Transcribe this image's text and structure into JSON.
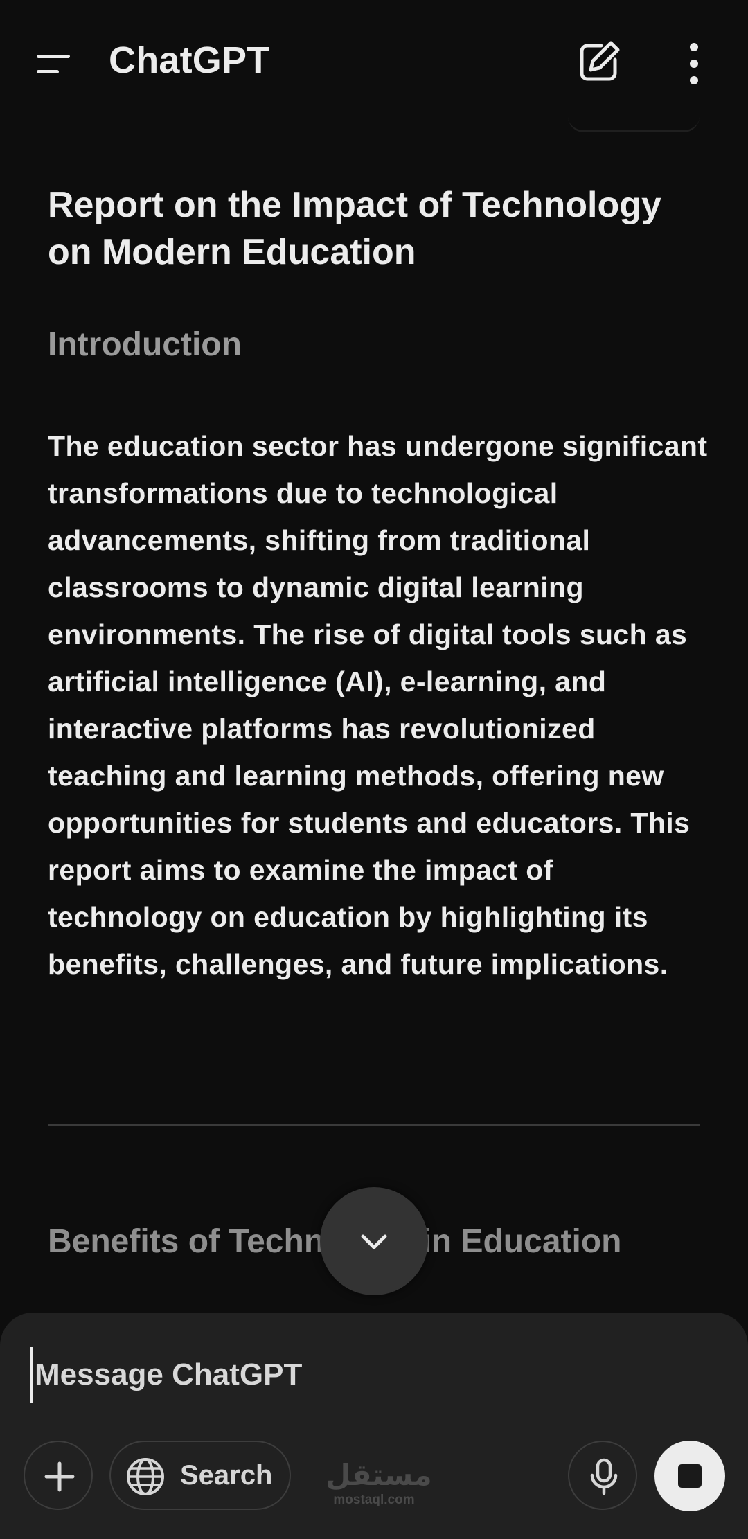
{
  "header": {
    "app_title": "ChatGPT",
    "menu_icon": "hamburger-menu-icon",
    "new_chat_icon": "compose-icon",
    "more_icon": "vertical-ellipsis-icon"
  },
  "document": {
    "title": "Report on the Impact of Technology on Modern Education",
    "sections": [
      {
        "heading": "Introduction",
        "body": "The education sector has undergone significant transformations due to technological advancements, shifting from traditional classrooms to dynamic digital learning environments. The rise of digital tools such as artificial intelligence (AI), e-learning, and interactive platforms has revolutionized teaching and learning methods, offering new opportunities for students and educators. This report aims to examine the impact of technology on education by highlighting its benefits, challenges, and future implications."
      },
      {
        "heading": "Benefits of Technology in Education"
      }
    ]
  },
  "scroll_down": {
    "icon": "chevron-down-icon"
  },
  "composer": {
    "placeholder": "Message ChatGPT",
    "value": "",
    "attach_icon": "plus-icon",
    "search_label": "Search",
    "search_icon": "globe-icon",
    "mic_icon": "microphone-icon",
    "stop_icon": "stop-icon"
  },
  "watermark": {
    "arabic": "مستقل",
    "latin": "mostaql.com"
  },
  "colors": {
    "background": "#0d0d0d",
    "text": "#ececec",
    "muted_heading": "#9a9a9a",
    "composer_bg": "#212121",
    "scroll_button_bg": "#333333"
  }
}
